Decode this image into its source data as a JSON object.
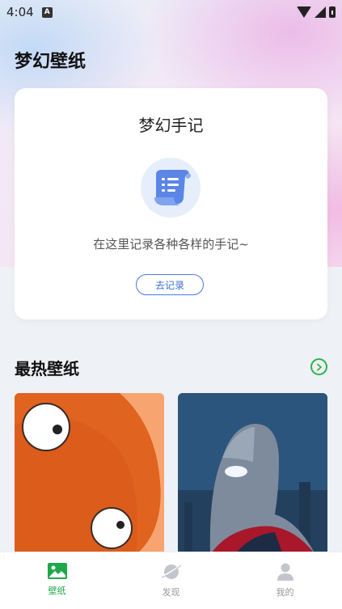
{
  "status_bar": {
    "time": "4:04",
    "notification_badge": "A"
  },
  "app": {
    "title": "梦幻壁纸"
  },
  "note_card": {
    "title": "梦幻手记",
    "description": "在这里记录各种各样的手记~",
    "button_label": "去记录"
  },
  "hot_section": {
    "title": "最热壁纸"
  },
  "tabs": [
    {
      "label": "壁纸",
      "icon": "image-icon",
      "active": true
    },
    {
      "label": "发现",
      "icon": "planet-icon",
      "active": false
    },
    {
      "label": "我的",
      "icon": "person-icon",
      "active": false
    }
  ],
  "colors": {
    "accent": "#1ea84a",
    "button_blue": "#4a7be5"
  }
}
